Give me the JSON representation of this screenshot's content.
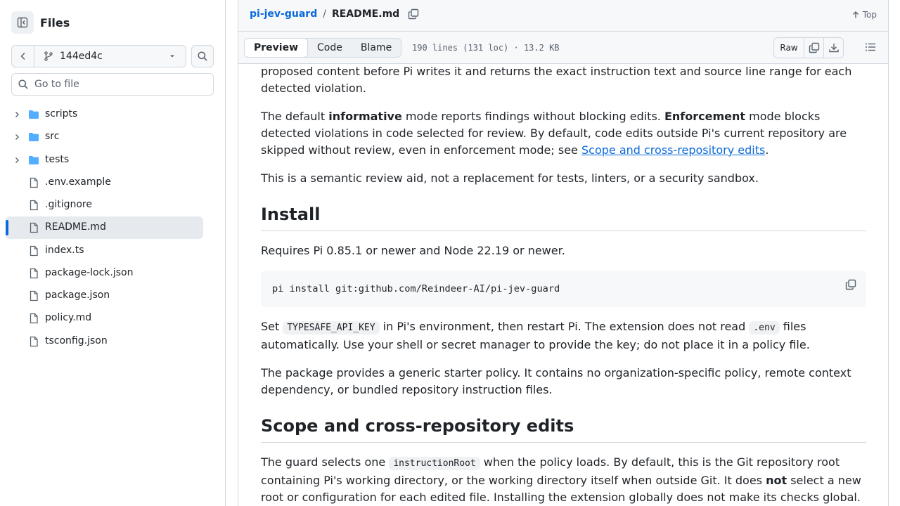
{
  "sidebar": {
    "title": "Files",
    "branch": "144ed4c",
    "goto_placeholder": "Go to file",
    "items": [
      {
        "name": "scripts",
        "kind": "folder"
      },
      {
        "name": "src",
        "kind": "folder"
      },
      {
        "name": "tests",
        "kind": "folder"
      },
      {
        "name": ".env.example",
        "kind": "file"
      },
      {
        "name": ".gitignore",
        "kind": "file"
      },
      {
        "name": "README.md",
        "kind": "file",
        "active": true
      },
      {
        "name": "index.ts",
        "kind": "file"
      },
      {
        "name": "package-lock.json",
        "kind": "file"
      },
      {
        "name": "package.json",
        "kind": "file"
      },
      {
        "name": "policy.md",
        "kind": "file"
      },
      {
        "name": "tsconfig.json",
        "kind": "file"
      }
    ]
  },
  "header": {
    "repo": "pi-jev-guard",
    "separator": "/",
    "file": "README.md",
    "top_label": "Top"
  },
  "filebar": {
    "tabs": [
      "Preview",
      "Code",
      "Blame"
    ],
    "active_tab": "Preview",
    "meta": "190 lines (131 loc) · 13.2 KB",
    "raw_label": "Raw"
  },
  "readme": {
    "p0": "proposed content before Pi writes it and returns the exact instruction text and source line range for each detected violation.",
    "p1_a": "The default ",
    "p1_b": "informative",
    "p1_c": " mode reports findings without blocking edits. ",
    "p1_d": "Enforcement",
    "p1_e": " mode blocks detected violations in code selected for review. By default, code edits outside Pi's current repository are skipped without review, even in enforcement mode; see ",
    "p1_link": "Scope and cross-repository edits",
    "p1_f": ".",
    "p2": "This is a semantic review aid, not a replacement for tests, linters, or a security sandbox.",
    "h_install": "Install",
    "p3": "Requires Pi 0.85.1 or newer and Node 22.19 or newer.",
    "code1": "pi install git:github.com/Reindeer-AI/pi-jev-guard",
    "p4_a": "Set ",
    "p4_code1": "TYPESAFE_API_KEY",
    "p4_b": " in Pi's environment, then restart Pi. The extension does not read ",
    "p4_code2": ".env",
    "p4_c": " files automatically. Use your shell or secret manager to provide the key; do not place it in a policy file.",
    "p5": "The package provides a generic starter policy. It contains no organization-specific policy, remote context dependency, or bundled repository instruction files.",
    "h_scope": "Scope and cross-repository edits",
    "p6_a": "The guard selects one ",
    "p6_code": "instructionRoot",
    "p6_b": " when the policy loads. By default, this is the Git repository root containing Pi's working directory, or the working directory itself when outside Git. It does ",
    "p6_bold": "not",
    "p6_c": " select a new root or configuration for each edited file. Installing the extension globally does not make its checks global."
  },
  "colors": {
    "accent": "#0969da",
    "folder": "#54aeff",
    "border": "#d1d9e0",
    "muted": "#59636e"
  },
  "icons": {
    "panel": "sidebar-collapse-icon",
    "back": "chevron-left-icon",
    "branch": "git-branch-icon",
    "search": "search-icon",
    "folder": "folder-icon",
    "file": "file-icon",
    "copy": "copy-icon",
    "download": "download-icon",
    "outline": "list-unordered-icon",
    "top": "arrow-up-icon"
  }
}
